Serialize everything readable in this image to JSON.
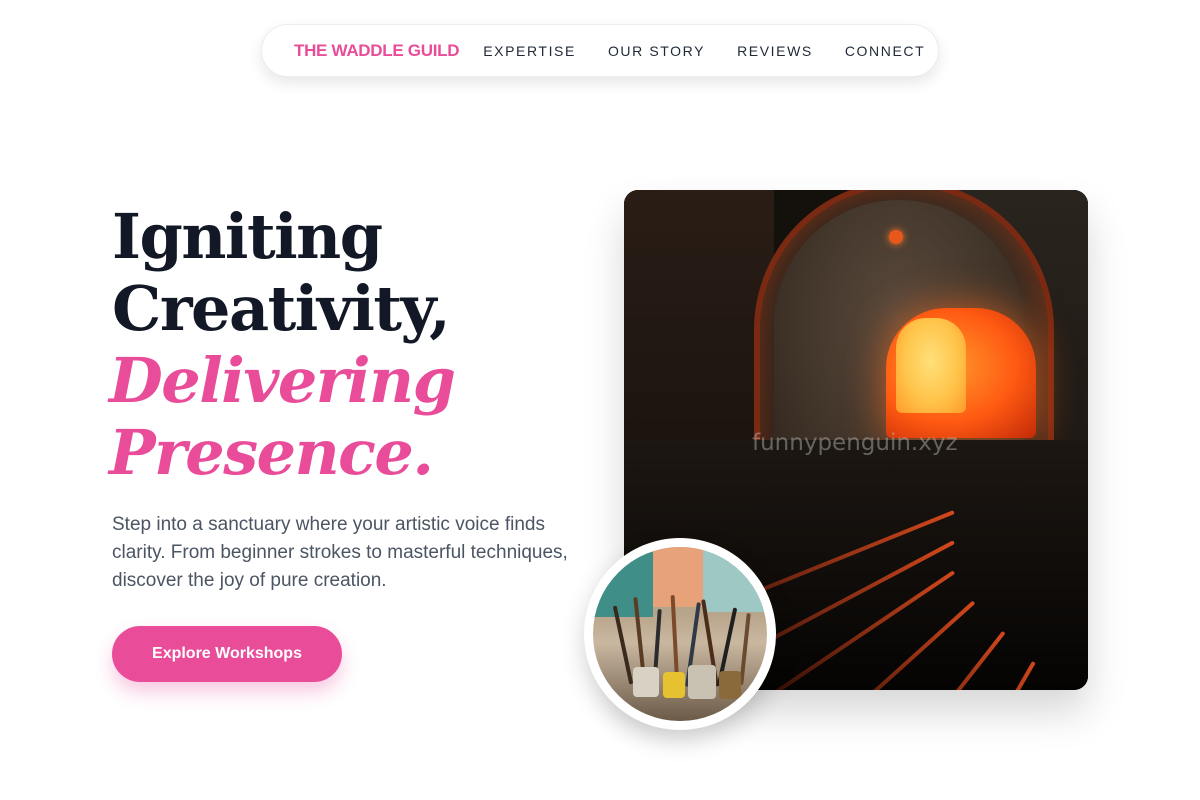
{
  "nav": {
    "brand": "THE WADDLE GUILD",
    "links": [
      {
        "label": "EXPERTISE"
      },
      {
        "label": "OUR STORY"
      },
      {
        "label": "REVIEWS"
      },
      {
        "label": "CONNECT"
      }
    ]
  },
  "hero": {
    "title_line1": "Igniting",
    "title_line2": "Creativity,",
    "accent_line1": "Delivering",
    "accent_line2": "Presence.",
    "description": "Step into a sanctuary where your artistic voice finds clarity. From beginner strokes to masterful techniques, discover the joy of pure creation.",
    "cta_label": "Explore Workshops"
  },
  "media": {
    "main_watermark": "funnypenguin.xyz"
  },
  "colors": {
    "accent": "#e94d9a",
    "heading": "#121826",
    "body_text": "#4b5563"
  }
}
